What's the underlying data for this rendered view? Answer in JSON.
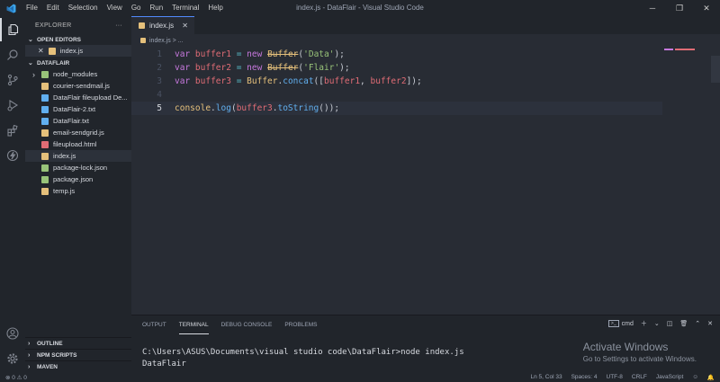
{
  "menu": [
    "File",
    "Edit",
    "Selection",
    "View",
    "Go",
    "Run",
    "Terminal",
    "Help"
  ],
  "window_title": "index.js - DataFlair - Visual Studio Code",
  "sidebar": {
    "title": "EXPLORER",
    "more": "···",
    "open_editors_label": "OPEN EDITORS",
    "open_editor_file": "index.js",
    "folder_label": "DATAFLAIR",
    "files": [
      {
        "name": "node_modules",
        "type": "folder"
      },
      {
        "name": "courier-sendmail.js",
        "type": "js"
      },
      {
        "name": "DataFlair fileupload De...",
        "type": "txt"
      },
      {
        "name": "DataFlair-2.txt",
        "type": "txt"
      },
      {
        "name": "DataFlair.txt",
        "type": "txt"
      },
      {
        "name": "email-sendgrid.js",
        "type": "js"
      },
      {
        "name": "fileupload.html",
        "type": "html"
      },
      {
        "name": "index.js",
        "type": "js"
      },
      {
        "name": "package-lock.json",
        "type": "json"
      },
      {
        "name": "package.json",
        "type": "json"
      },
      {
        "name": "temp.js",
        "type": "js"
      }
    ],
    "bottom_sections": [
      "OUTLINE",
      "NPM SCRIPTS",
      "MAVEN"
    ]
  },
  "editor": {
    "tab_label": "index.js",
    "breadcrumb": "index.js > ...",
    "line_numbers": [
      "1",
      "2",
      "3",
      "4",
      "5"
    ]
  },
  "panel": {
    "tabs": [
      "OUTPUT",
      "TERMINAL",
      "DEBUG CONSOLE",
      "PROBLEMS"
    ],
    "shell": "cmd",
    "terminal_lines": [
      "C:\\Users\\ASUS\\Documents\\visual studio code\\DataFlair>node index.js",
      "DataFlair"
    ],
    "activate_title": "Activate Windows",
    "activate_sub": "Go to Settings to activate Windows."
  },
  "statusbar": {
    "problems": "⊗ 0 ⚠ 0",
    "position": "Ln 5, Col 33",
    "spaces": "Spaces: 4",
    "encoding": "UTF-8",
    "eol": "CRLF",
    "language": "JavaScript"
  },
  "colors": {
    "accent": "#528bff",
    "background": "#282c34",
    "sidebar": "#21252b"
  }
}
